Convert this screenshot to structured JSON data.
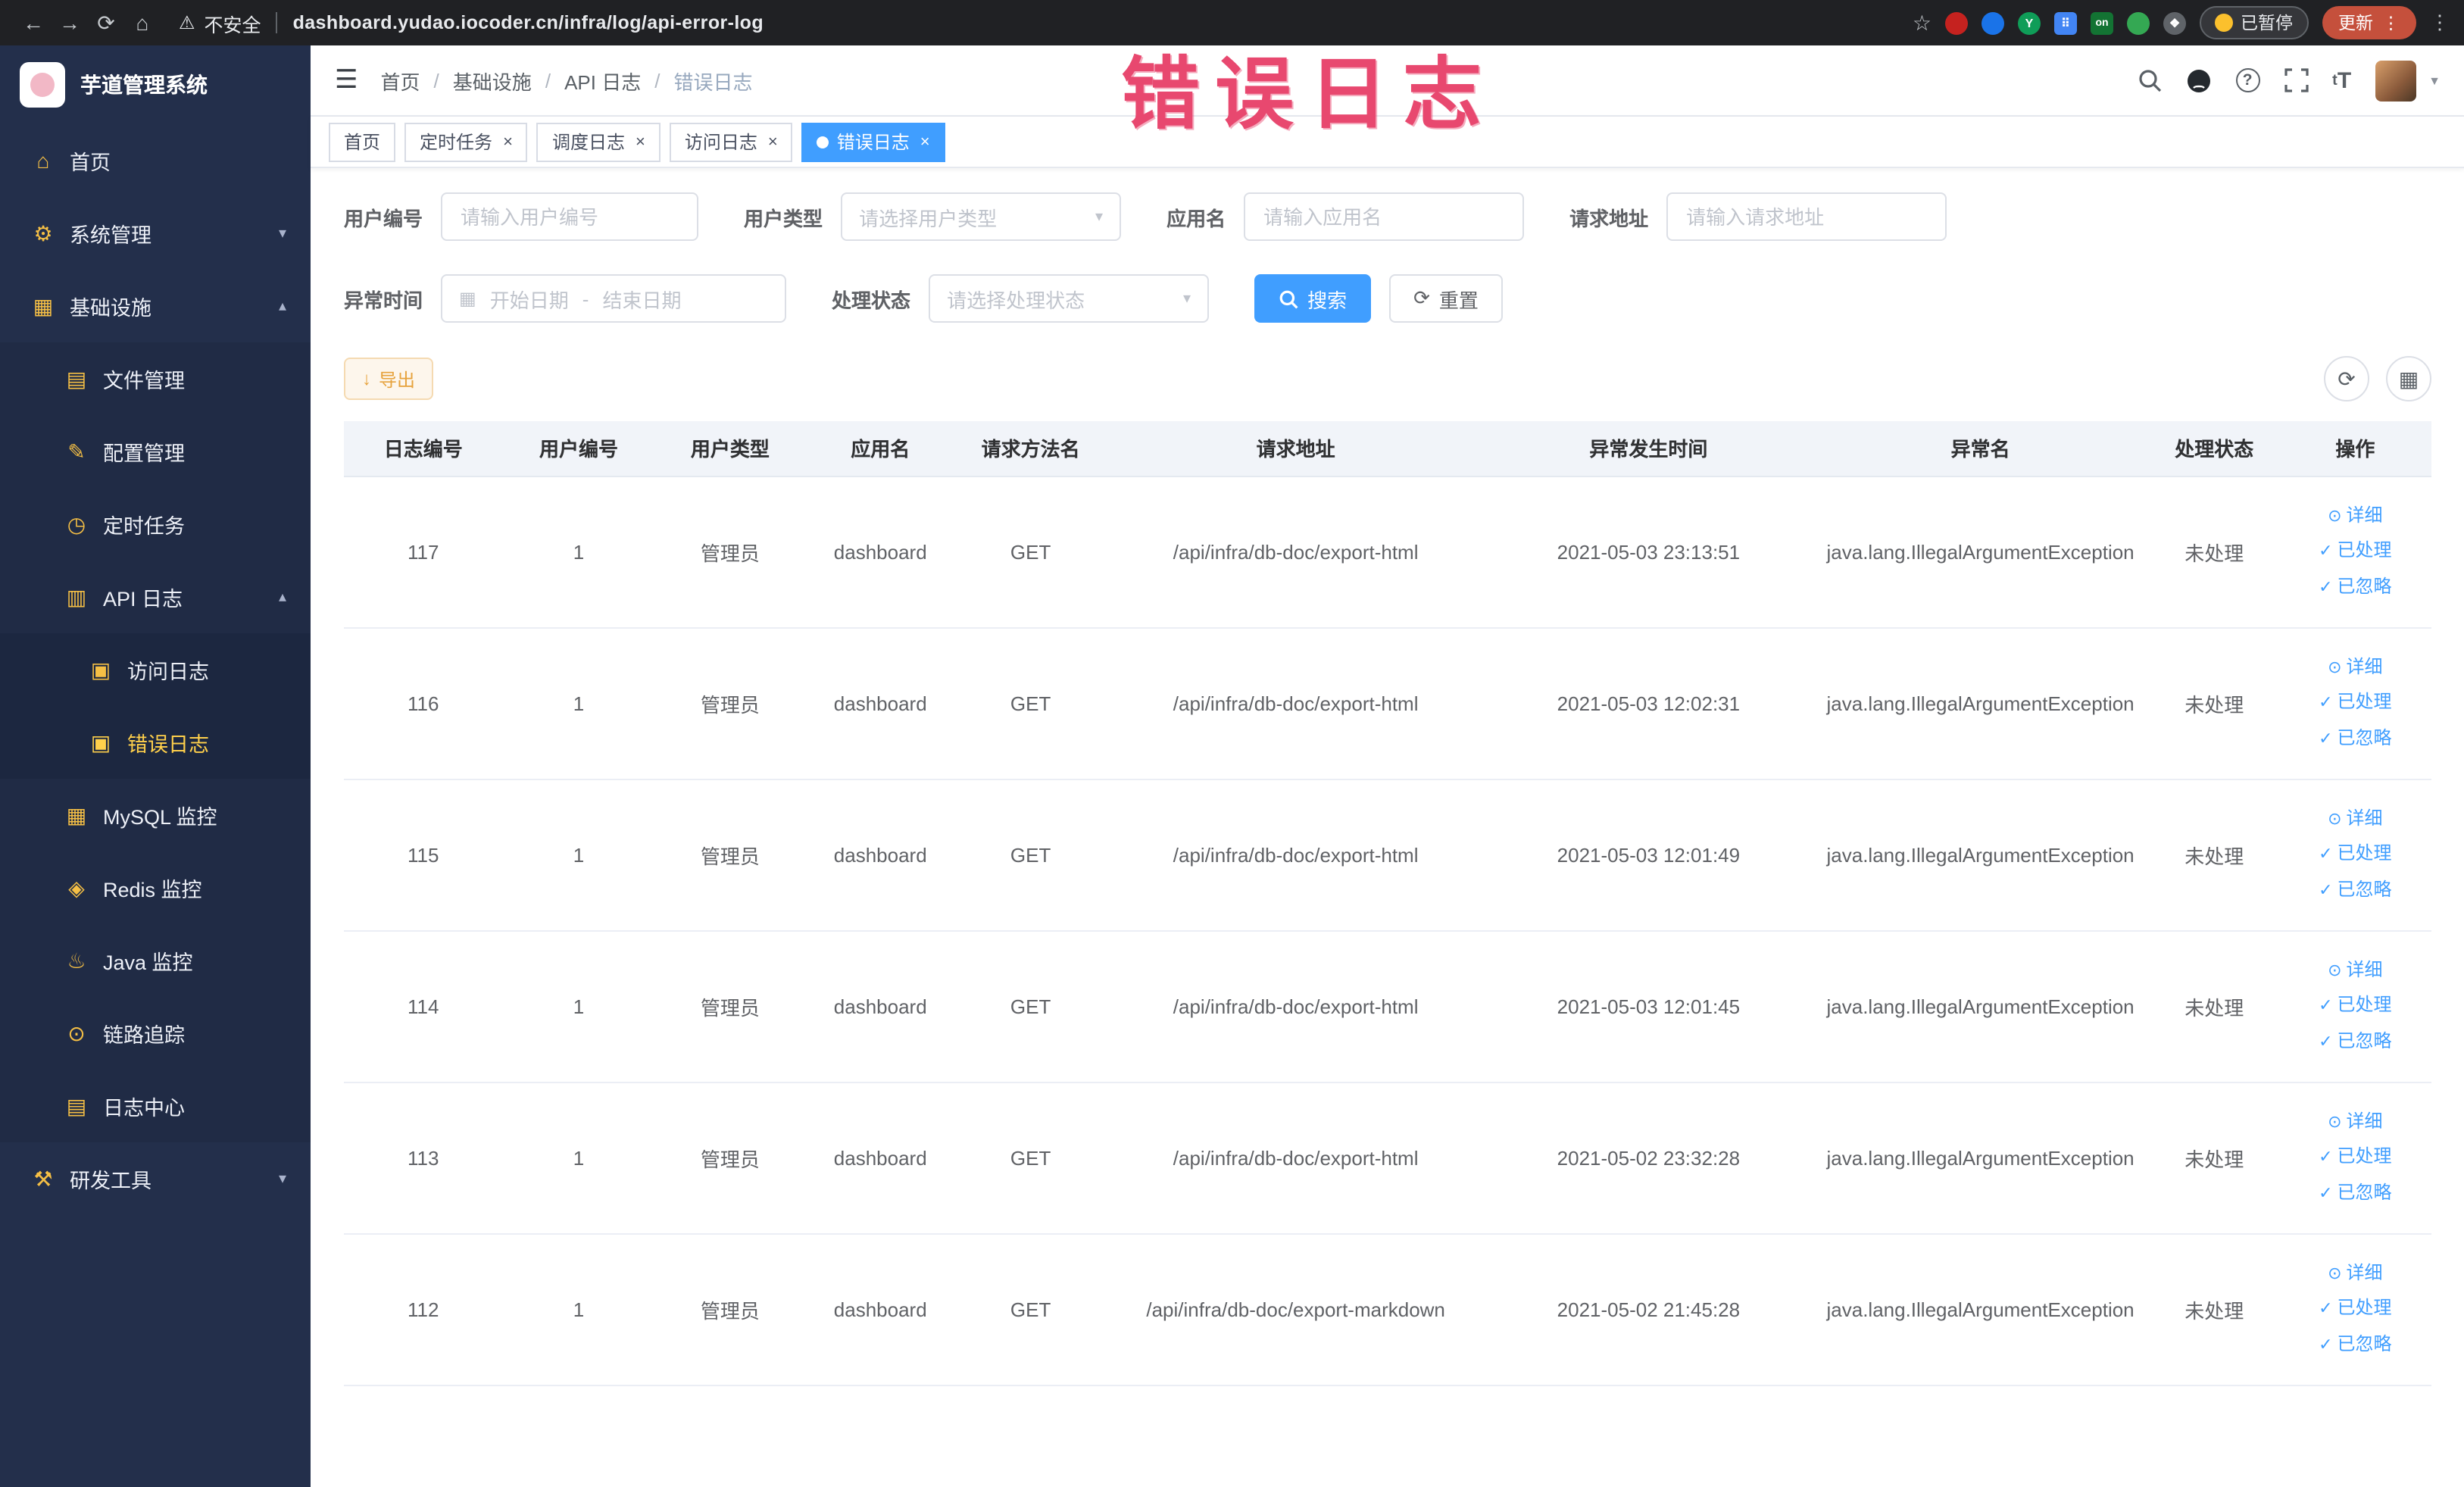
{
  "colors": {
    "accent": "#409eff",
    "warning": "#e6a23c",
    "annotation": "#e8486f",
    "sidebar_bg": "#232f4b",
    "active_menu": "#ffd04b"
  },
  "browser": {
    "security_label": "不安全",
    "url": "dashboard.yudao.iocoder.cn/infra/log/api-error-log",
    "paused_badge": "已暂停",
    "update_button": "更新"
  },
  "annotation_text": "错误日志",
  "sidebar": {
    "logo_title": "芋道管理系统",
    "items": [
      {
        "label": "首页"
      },
      {
        "label": "系统管理"
      },
      {
        "label": "基础设施"
      },
      {
        "label": "文件管理"
      },
      {
        "label": "配置管理"
      },
      {
        "label": "定时任务"
      },
      {
        "label": "API 日志"
      },
      {
        "label": "访问日志"
      },
      {
        "label": "错误日志"
      },
      {
        "label": "MySQL 监控"
      },
      {
        "label": "Redis 监控"
      },
      {
        "label": "Java 监控"
      },
      {
        "label": "链路追踪"
      },
      {
        "label": "日志中心"
      },
      {
        "label": "研发工具"
      }
    ]
  },
  "breadcrumb": {
    "items": [
      "首页",
      "基础设施",
      "API 日志",
      "错误日志"
    ]
  },
  "tabs": [
    {
      "label": "首页"
    },
    {
      "label": "定时任务"
    },
    {
      "label": "调度日志"
    },
    {
      "label": "访问日志"
    },
    {
      "label": "错误日志"
    }
  ],
  "filters": {
    "user_id": {
      "label": "用户编号",
      "placeholder": "请输入用户编号"
    },
    "user_type": {
      "label": "用户类型",
      "placeholder": "请选择用户类型"
    },
    "app_name": {
      "label": "应用名",
      "placeholder": "请输入应用名"
    },
    "request_url": {
      "label": "请求地址",
      "placeholder": "请输入请求地址"
    },
    "exception_time": {
      "label": "异常时间",
      "start_placeholder": "开始日期",
      "separator": "-",
      "end_placeholder": "结束日期"
    },
    "status": {
      "label": "处理状态",
      "placeholder": "请选择处理状态"
    },
    "search_button": "搜索",
    "reset_button": "重置"
  },
  "toolbar": {
    "export_button": "导出"
  },
  "table": {
    "columns": [
      "日志编号",
      "用户编号",
      "用户类型",
      "应用名",
      "请求方法名",
      "请求地址",
      "异常发生时间",
      "异常名",
      "处理状态",
      "操作"
    ],
    "rows": [
      {
        "log_id": "117",
        "user_id": "1",
        "user_type": "管理员",
        "app_name": "dashboard",
        "method": "GET",
        "request_url": "/api/infra/db-doc/export-html",
        "time": "2021-05-03 23:13:51",
        "exception": "java.lang.IllegalArgumentException",
        "status": "未处理"
      },
      {
        "log_id": "116",
        "user_id": "1",
        "user_type": "管理员",
        "app_name": "dashboard",
        "method": "GET",
        "request_url": "/api/infra/db-doc/export-html",
        "time": "2021-05-03 12:02:31",
        "exception": "java.lang.IllegalArgumentException",
        "status": "未处理"
      },
      {
        "log_id": "115",
        "user_id": "1",
        "user_type": "管理员",
        "app_name": "dashboard",
        "method": "GET",
        "request_url": "/api/infra/db-doc/export-html",
        "time": "2021-05-03 12:01:49",
        "exception": "java.lang.IllegalArgumentException",
        "status": "未处理"
      },
      {
        "log_id": "114",
        "user_id": "1",
        "user_type": "管理员",
        "app_name": "dashboard",
        "method": "GET",
        "request_url": "/api/infra/db-doc/export-html",
        "time": "2021-05-03 12:01:45",
        "exception": "java.lang.IllegalArgumentException",
        "status": "未处理"
      },
      {
        "log_id": "113",
        "user_id": "1",
        "user_type": "管理员",
        "app_name": "dashboard",
        "method": "GET",
        "request_url": "/api/infra/db-doc/export-html",
        "time": "2021-05-02 23:32:28",
        "exception": "java.lang.IllegalArgumentException",
        "status": "未处理"
      },
      {
        "log_id": "112",
        "user_id": "1",
        "user_type": "管理员",
        "app_name": "dashboard",
        "method": "GET",
        "request_url": "/api/infra/db-doc/export-markdown",
        "time": "2021-05-02 21:45:28",
        "exception": "java.lang.IllegalArgumentException",
        "status": "未处理"
      }
    ]
  },
  "row_actions": {
    "detail": "详细",
    "processed": "已处理",
    "ignored": "已忽略"
  }
}
